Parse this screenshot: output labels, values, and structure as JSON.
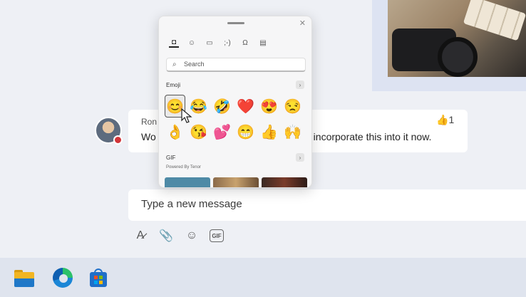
{
  "chat": {
    "sender": "Ron",
    "message_start": "Wo",
    "message_end": "d incorporate this into it now.",
    "reaction_emoji": "👍",
    "reaction_count": "1"
  },
  "composer": {
    "placeholder": "Type a new message"
  },
  "toolbar": [
    {
      "name": "format-icon",
      "glyph": "A̷"
    },
    {
      "name": "attach-icon",
      "glyph": "📎"
    },
    {
      "name": "emoji-icon",
      "glyph": "☺"
    },
    {
      "name": "gif-icon",
      "glyph": "GIF"
    }
  ],
  "picker": {
    "close_glyph": "✕",
    "categories": [
      {
        "icon": "sticker-icon",
        "glyph": "◘"
      },
      {
        "icon": "smiley-icon",
        "glyph": "☺"
      },
      {
        "icon": "gif-icon",
        "glyph": "▭"
      },
      {
        "icon": "kaomoji-icon",
        "glyph": ";-)"
      },
      {
        "icon": "symbols-icon",
        "glyph": "Ω"
      },
      {
        "icon": "clipboard-icon",
        "glyph": "▤"
      }
    ],
    "search_placeholder": "Search",
    "emoji_label": "Emoji",
    "emojis": [
      "😊",
      "😂",
      "🤣",
      "❤️",
      "😍",
      "😒",
      "👌",
      "😘",
      "💕",
      "😁",
      "👍",
      "🙌"
    ],
    "gif_label": "GIF",
    "powered_by": "Powered By Tenor",
    "more_glyph": "›"
  },
  "colors": {
    "accent": "#6264a7",
    "presence": "#d13438"
  }
}
